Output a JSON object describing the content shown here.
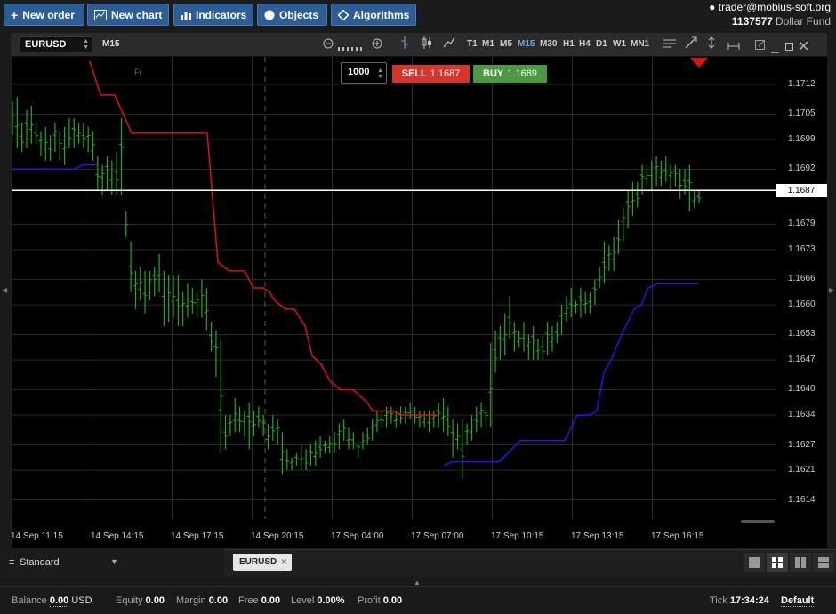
{
  "toolbar": {
    "new_order": "New order",
    "new_chart": "New chart",
    "indicators": "Indicators",
    "objects": "Objects",
    "algorithms": "Algorithms"
  },
  "account": {
    "email": "trader@mobius-soft.org",
    "id": "1137577",
    "fund": "Dollar Fund"
  },
  "chart": {
    "symbol": "EURUSD",
    "timeframe": "M15",
    "timeframes": [
      "T1",
      "M1",
      "M5",
      "M15",
      "M30",
      "H1",
      "H4",
      "D1",
      "W1",
      "MN1"
    ],
    "active_timeframe": "M15",
    "day_marker": "Fr",
    "quantity": "1000",
    "sell_label": "SELL",
    "sell_price": "1.1687",
    "buy_label": "BUY",
    "buy_price": "1.1689",
    "current_price": "1.1687"
  },
  "chart_data": {
    "type": "bar",
    "y_ticks": [
      "1.1712",
      "1.1705",
      "1.1699",
      "1.1692",
      "1.1679",
      "1.1673",
      "1.1666",
      "1.1660",
      "1.1653",
      "1.1647",
      "1.1640",
      "1.1634",
      "1.1627",
      "1.1621",
      "1.1614"
    ],
    "x_ticks": [
      "14 Sep 11:15",
      "14 Sep 14:15",
      "14 Sep 17:15",
      "14 Sep 20:15",
      "17 Sep 04:00",
      "17 Sep 07:00",
      "17 Sep 10:15",
      "17 Sep 13:15",
      "17 Sep 16:15"
    ],
    "ylim": [
      1.16095,
      1.17185
    ],
    "current_price_line": 1.1687,
    "colors": {
      "bars": "#22aa22",
      "upper_band": "#e01010",
      "lower_band": "#1a1aee",
      "price_line": "#ffffff"
    }
  },
  "bottom": {
    "layout_name": "Standard",
    "tab": "EURUSD"
  },
  "status": {
    "balance_label": "Balance",
    "balance_value": "0.00",
    "balance_currency": "USD",
    "equity_label": "Equity",
    "equity_value": "0.00",
    "margin_label": "Margin",
    "margin_value": "0.00",
    "free_label": "Free",
    "free_value": "0.00",
    "level_label": "Level",
    "level_value": "0.00%",
    "profit_label": "Profit",
    "profit_value": "0.00",
    "tick_label": "Tick",
    "tick_value": "17:34:24",
    "server": "Default"
  }
}
